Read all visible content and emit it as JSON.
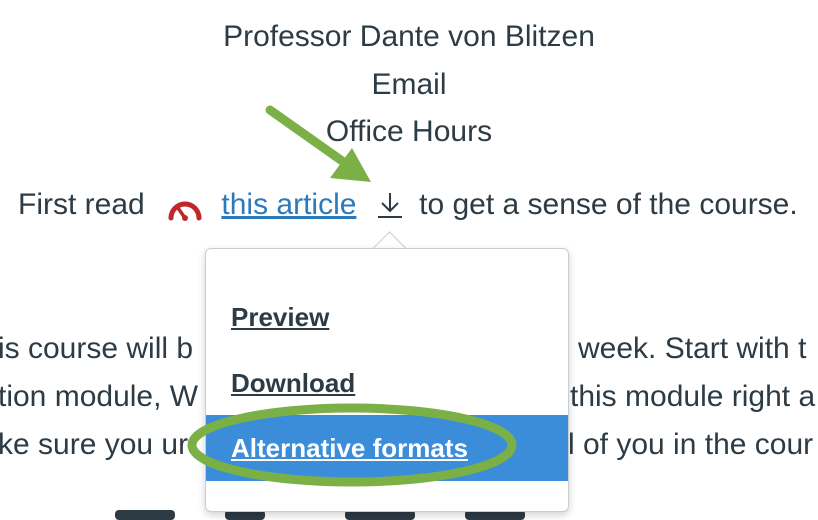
{
  "header": {
    "professor": "Professor Dante von Blitzen",
    "email": "Email",
    "office_hours": "Office Hours"
  },
  "read_line": {
    "prefix": "First read",
    "link_text": "this article",
    "suffix": "to get a sense of the course."
  },
  "body_fragments": {
    "line1_left": "is course will b",
    "line1_right": "week. Start with t",
    "line2_left": "tion module, W",
    "line2_right": "this module right a",
    "line3_left": "ke sure you ur",
    "line3_right": "l of you in the cour"
  },
  "download_menu": {
    "items": [
      {
        "label": "Preview"
      },
      {
        "label": "Download"
      },
      {
        "label": "Alternative formats",
        "highlighted": true
      }
    ]
  },
  "colors": {
    "text": "#2d3b45",
    "link": "#2b7abc",
    "highlight": "#3b8cd9",
    "annotation_green": "#7bb046",
    "gauge_red": "#c0272d"
  },
  "icons": {
    "gauge": "accessibility-score-gauge-icon",
    "download": "download-arrow-icon"
  }
}
